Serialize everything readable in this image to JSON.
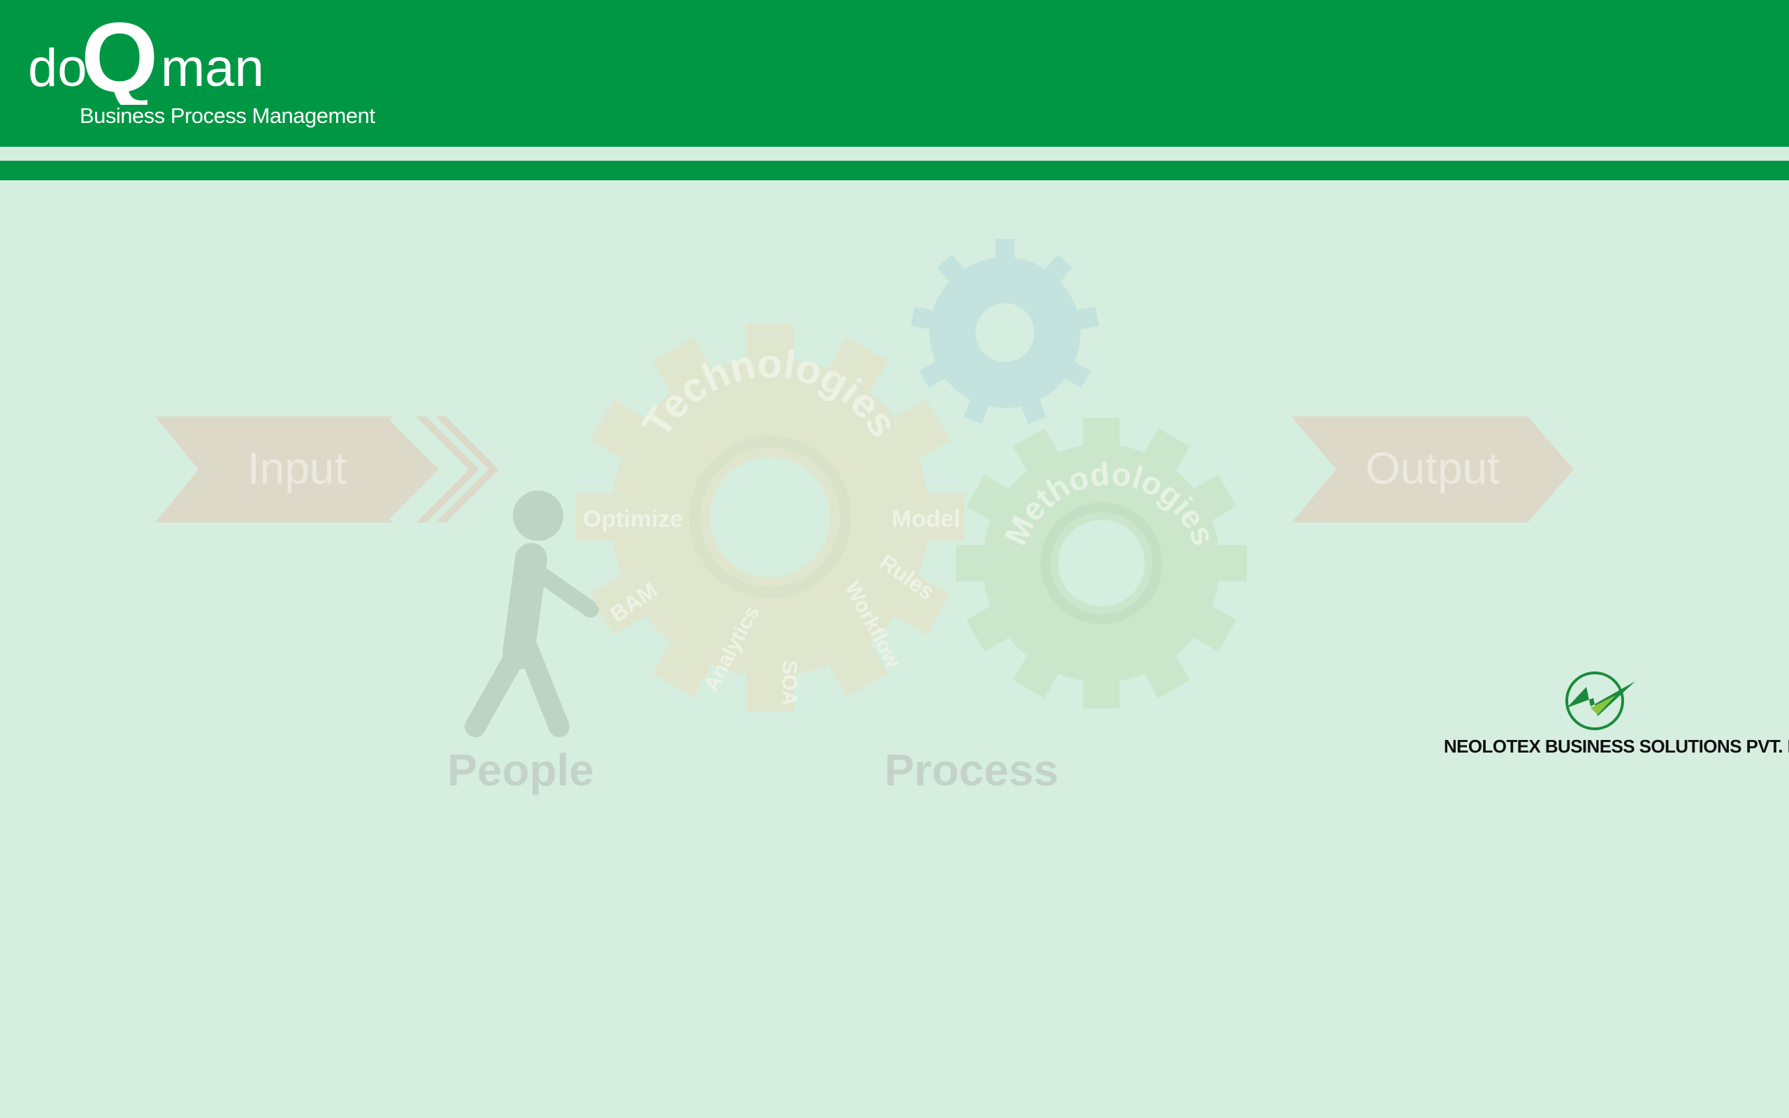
{
  "brand": {
    "name_left": "do",
    "name_mark": "Q",
    "name_right": "man",
    "subtitle": "Business Process Management",
    "header_color": "#009744"
  },
  "diagram": {
    "input_label": "Input",
    "output_label": "Output",
    "technologies_label": "Technologies",
    "methodologies_label": "Methodologies",
    "tech_items": [
      "Optimize",
      "Model",
      "BAM",
      "Rules",
      "Analytics",
      "Workflow",
      "SOA"
    ],
    "people_label": "People",
    "process_label": "Process"
  },
  "company": {
    "name": "NEOLOTEX BUSINESS SOLUTIONS PVT. LTD."
  }
}
